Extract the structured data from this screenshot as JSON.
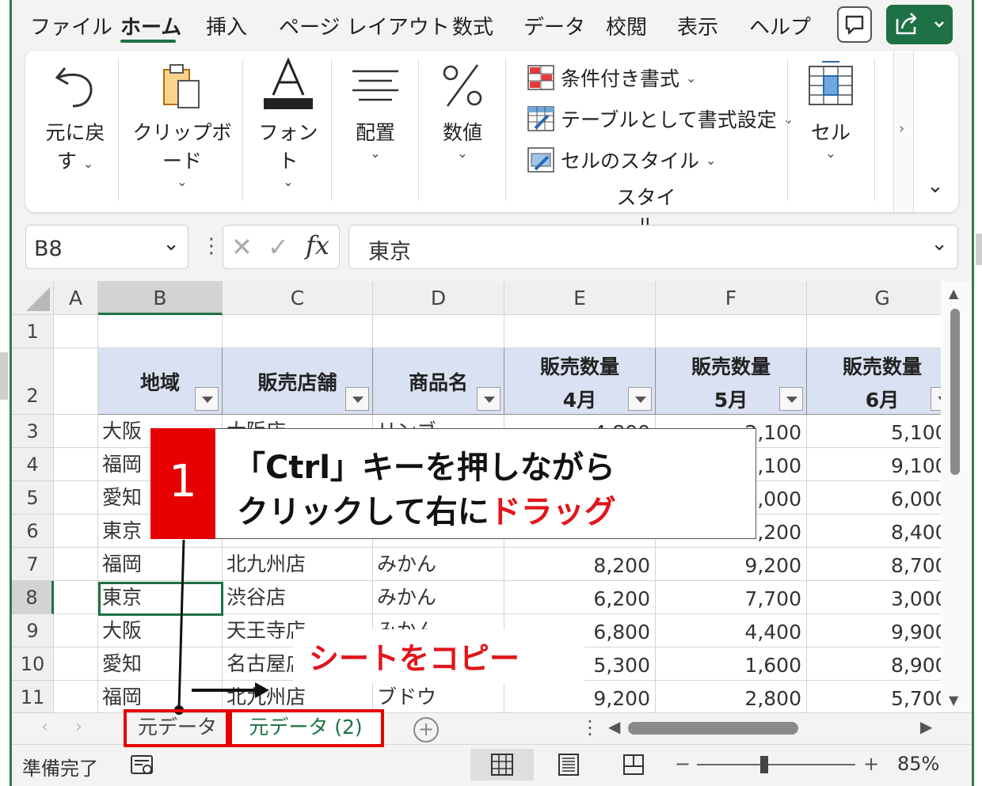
{
  "menu": {
    "tabs": [
      "ファイル",
      "ホーム",
      "挿入",
      "ページ レイアウト",
      "数式",
      "データ",
      "校閲",
      "表示",
      "ヘルプ"
    ],
    "active": "ホーム"
  },
  "ribbon": {
    "undo": {
      "line1": "元に戻",
      "line2": "す"
    },
    "clipboard": "クリップボード",
    "font": "フォント",
    "align": "配置",
    "number": "数値",
    "style_items": [
      "条件付き書式",
      "テーブルとして書式設定",
      "セルのスタイル"
    ],
    "style_group": "スタイル",
    "cells": "セル"
  },
  "formula_bar": {
    "name_box": "B8",
    "value": "東京"
  },
  "columns": [
    "A",
    "B",
    "C",
    "D",
    "E",
    "F",
    "G"
  ],
  "selected_column": "B",
  "selected_row": "8",
  "rows": [
    "1",
    "2",
    "3",
    "4",
    "5",
    "6",
    "7",
    "8",
    "9",
    "10",
    "11"
  ],
  "table": {
    "headers": [
      "地域",
      "販売店舗",
      "商品名",
      "販売数量",
      "販売数量",
      "販売数量"
    ],
    "header_months": [
      "",
      "",
      "",
      "4月",
      "5月",
      "6月"
    ],
    "data": [
      [
        "大阪",
        "大阪店",
        "リンゴ",
        "4,800",
        "2,100",
        "5,100"
      ],
      [
        "福岡",
        "",
        "",
        "",
        "9,100",
        "9,100"
      ],
      [
        "愛知",
        "",
        "",
        "",
        "5,000",
        "6,000"
      ],
      [
        "東京",
        "",
        "",
        "",
        "2,200",
        "8,400"
      ],
      [
        "福岡",
        "北九州店",
        "みかん",
        "8,200",
        "9,200",
        "8,700"
      ],
      [
        "東京",
        "渋谷店",
        "みかん",
        "6,200",
        "7,700",
        "3,000"
      ],
      [
        "大阪",
        "天王寺店",
        "みかん",
        "6,800",
        "4,400",
        "9,900"
      ],
      [
        "愛知",
        "名古屋店",
        "",
        "5,300",
        "1,600",
        "8,900"
      ],
      [
        "福岡",
        "北九州店",
        "ブドウ",
        "9,200",
        "2,800",
        "5,700"
      ]
    ]
  },
  "sheets": [
    "元データ",
    "元データ (2)"
  ],
  "status": {
    "ready": "準備完了",
    "zoom_minus": "−",
    "zoom_plus": "+",
    "zoom": "85%"
  },
  "annotation": {
    "step": "1",
    "line1": "「Ctrl」キーを押しながら",
    "line2_black": "クリックして右に",
    "line2_red": "ドラッグ",
    "copy_label": "シートをコピー"
  },
  "colors": {
    "excel_green": "#1e7145",
    "header_fill": "#d9e1f2",
    "annotation_red": "#e60000"
  }
}
